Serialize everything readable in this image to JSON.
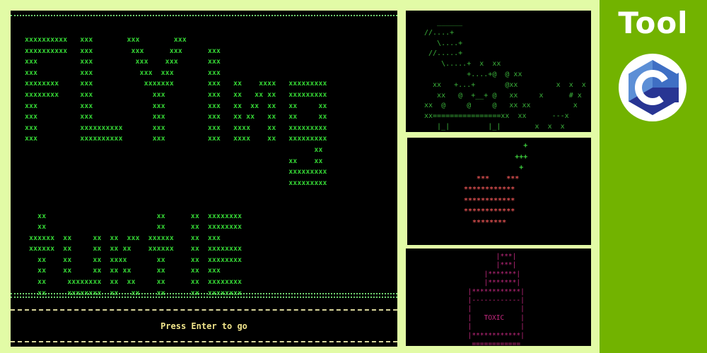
{
  "main_terminal": {
    "title_art": "xxxxxxxxxx   xxx        xxx        xxx\nxxxxxxxxxx   xxx         xxx      xxx      xxx\nxxx          xxx          xxx    xxx       xxx\nxxx          xxx           xxx  xxx        xxx\nxxxxxxxx     xxx            xxxxxxx        xxx   xx    xxxx   xxxxxxxxx\nxxxxxxxx     xxx              xxx          xxx   xx   xx xx   xxxxxxxxx\nxxx          xxx              xxx          xxx   xx  xx  xx   xx     xx\nxxx          xxx              xxx          xxx   xx xx   xx   xx     xx\nxxx          xxxxxxxxxx       xxx          xxx   xxxx    xx   xxxxxxxxx\nxxx          xxxxxxxxxx       xxx          xxx   xxxx    xx   xxxxxxxxx\n                                                                    xx\n                                                              xx    xx\n                                                              xxxxxxxxx\n                                                              xxxxxxxxx\n\n\n   xx                          xx      xx  xxxxxxxx\n   xx                          xx      xx  xxxxxxxx\n xxxxxx  xx     xx  xx  xxx  xxxxxx    xx  xxx\n xxxxxx  xx     xx  xx xx    xxxxxx    xx  xxxxxxxx\n   xx    xx     xx  xxxx       xx      xx  xxxxxxxx\n   xx    xx     xx  xx xx      xx      xx  xxx\n   xx     xxxxxxxx  xx  xx     xx      xx  xxxxxxxx\n   xx     xxxxxxxx  xx   xx    xx      xx  xxxxxxxx",
    "prompt": "Press Enter to go"
  },
  "ship_panel": {
    "art": "   ______\n//....+\n   \\....+\n //.....+\n    \\.....+  x  xx\n          +....+@  @ xx\n  xx   +...+       @xx         x  x  x\n   xx   @  +__+ @   xx     x      # x\nxx  @     @     @   xx xx          x\nxx================xx  xx      ---x\n   |_|         |_|        x  x  x"
  },
  "tree_panel": {
    "top_art": "              +\n            +++\n             +",
    "body_art": "   ***    ***\n************\n************\n************\n  ********"
  },
  "toxic_panel": {
    "art": "        |***|\n        |***|\n     |*******|\n     |*******|\n |************|\n |------------|\n |            |\n |   TOXIC    |\n |            |\n |************|\n  ============"
  },
  "brand": {
    "title": "Tool",
    "logo_icon": "c-language-logo",
    "accent_color": "#72b300",
    "logo_dark": "#283593",
    "logo_light": "#5c8fd6"
  }
}
